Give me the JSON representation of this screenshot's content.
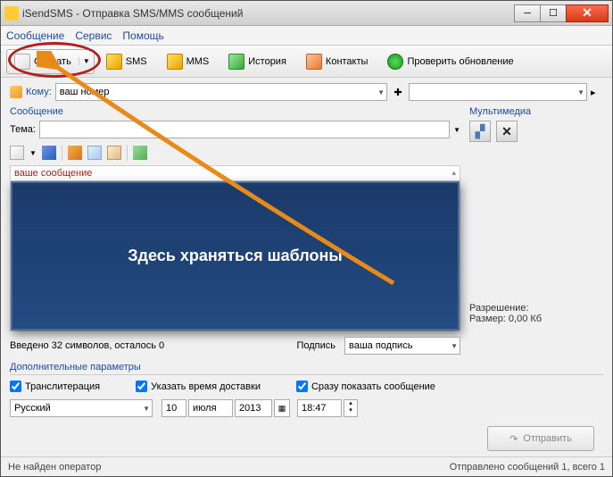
{
  "window": {
    "title": "iSendSMS - Отправка SMS/MMS сообщений"
  },
  "menu": {
    "message": "Сообщение",
    "service": "Сервис",
    "help": "Помощь"
  },
  "toolbar": {
    "create": "Создать",
    "sms": "SMS",
    "mms": "MMS",
    "history": "История",
    "contacts": "Контакты",
    "check_update": "Проверить обновление"
  },
  "to": {
    "label": "Кому:",
    "value": "ваш номер"
  },
  "message_label": "Сообщение",
  "theme_label": "Тема:",
  "theme_value": "",
  "msg_placeholder": "ваше сообщение",
  "annotation": "Здесь храняться шаблоны",
  "counter": "Введено 32 символов, осталось 0",
  "signature_label": "Подпись",
  "signature_value": "ваша подпись",
  "extra_label": "Дополнительные параметры",
  "checks": {
    "translit": "Транслитерация",
    "delivery_time": "Указать время доставки",
    "show_now": "Сразу показать сообщение"
  },
  "language": "Русский",
  "date": {
    "day": "10",
    "month": "июля",
    "year": "2013",
    "time": "18:47"
  },
  "multimedia": {
    "label": "Мультимедиа"
  },
  "resolution": {
    "label": "Разрешение:",
    "size": "Размер: 0,00 Кб"
  },
  "send": "Отправить",
  "status": {
    "left": "Не найден оператор",
    "right": "Отправлено сообщений 1, всего 1"
  }
}
